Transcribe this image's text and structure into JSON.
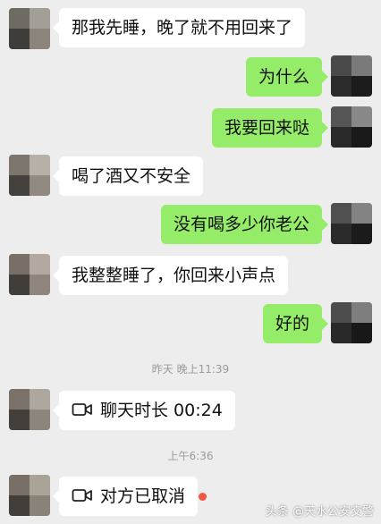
{
  "colors": {
    "background": "#ededed",
    "sent_bubble": "#95ec69",
    "received_bubble": "#ffffff",
    "timestamp": "#9a9a9a",
    "unread_dot": "#f25542"
  },
  "messages": [
    {
      "from": "contact",
      "text": "那我先睡，晚了就不用回来了"
    },
    {
      "from": "me",
      "text": "为什么"
    },
    {
      "from": "me",
      "text": "我要回来哒"
    },
    {
      "from": "contact",
      "text": "喝了酒又不安全"
    },
    {
      "from": "me",
      "text": "没有喝多少你老公"
    },
    {
      "from": "contact",
      "text": "我整整睡了，你回来小声点"
    },
    {
      "from": "me",
      "text": "好的"
    }
  ],
  "timestamps": [
    "昨天 晚上11:39",
    "上午6:36"
  ],
  "calls": [
    {
      "icon": "video-call-icon",
      "text": "聊天时长 00:24"
    },
    {
      "icon": "video-call-icon",
      "text": "对方已取消",
      "unread": true
    }
  ],
  "watermark": "头条 @天水公安交警"
}
